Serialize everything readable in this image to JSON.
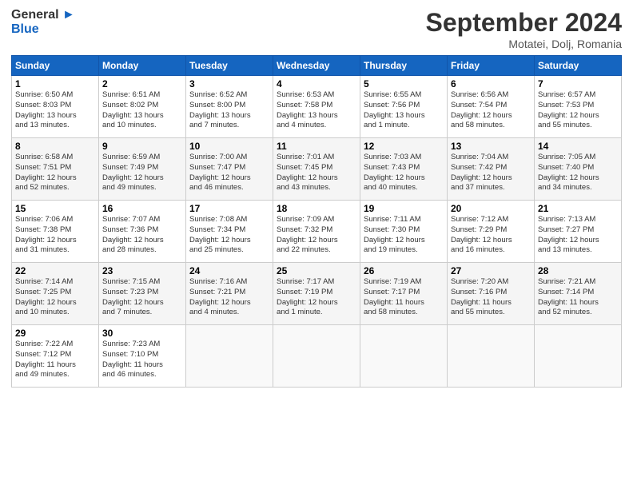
{
  "header": {
    "logo_line1": "General",
    "logo_line2": "Blue",
    "month": "September 2024",
    "location": "Motatei, Dolj, Romania"
  },
  "days_of_week": [
    "Sunday",
    "Monday",
    "Tuesday",
    "Wednesday",
    "Thursday",
    "Friday",
    "Saturday"
  ],
  "weeks": [
    [
      {
        "num": "1",
        "info": "Sunrise: 6:50 AM\nSunset: 8:03 PM\nDaylight: 13 hours\nand 13 minutes."
      },
      {
        "num": "2",
        "info": "Sunrise: 6:51 AM\nSunset: 8:02 PM\nDaylight: 13 hours\nand 10 minutes."
      },
      {
        "num": "3",
        "info": "Sunrise: 6:52 AM\nSunset: 8:00 PM\nDaylight: 13 hours\nand 7 minutes."
      },
      {
        "num": "4",
        "info": "Sunrise: 6:53 AM\nSunset: 7:58 PM\nDaylight: 13 hours\nand 4 minutes."
      },
      {
        "num": "5",
        "info": "Sunrise: 6:55 AM\nSunset: 7:56 PM\nDaylight: 13 hours\nand 1 minute."
      },
      {
        "num": "6",
        "info": "Sunrise: 6:56 AM\nSunset: 7:54 PM\nDaylight: 12 hours\nand 58 minutes."
      },
      {
        "num": "7",
        "info": "Sunrise: 6:57 AM\nSunset: 7:53 PM\nDaylight: 12 hours\nand 55 minutes."
      }
    ],
    [
      {
        "num": "8",
        "info": "Sunrise: 6:58 AM\nSunset: 7:51 PM\nDaylight: 12 hours\nand 52 minutes."
      },
      {
        "num": "9",
        "info": "Sunrise: 6:59 AM\nSunset: 7:49 PM\nDaylight: 12 hours\nand 49 minutes."
      },
      {
        "num": "10",
        "info": "Sunrise: 7:00 AM\nSunset: 7:47 PM\nDaylight: 12 hours\nand 46 minutes."
      },
      {
        "num": "11",
        "info": "Sunrise: 7:01 AM\nSunset: 7:45 PM\nDaylight: 12 hours\nand 43 minutes."
      },
      {
        "num": "12",
        "info": "Sunrise: 7:03 AM\nSunset: 7:43 PM\nDaylight: 12 hours\nand 40 minutes."
      },
      {
        "num": "13",
        "info": "Sunrise: 7:04 AM\nSunset: 7:42 PM\nDaylight: 12 hours\nand 37 minutes."
      },
      {
        "num": "14",
        "info": "Sunrise: 7:05 AM\nSunset: 7:40 PM\nDaylight: 12 hours\nand 34 minutes."
      }
    ],
    [
      {
        "num": "15",
        "info": "Sunrise: 7:06 AM\nSunset: 7:38 PM\nDaylight: 12 hours\nand 31 minutes."
      },
      {
        "num": "16",
        "info": "Sunrise: 7:07 AM\nSunset: 7:36 PM\nDaylight: 12 hours\nand 28 minutes."
      },
      {
        "num": "17",
        "info": "Sunrise: 7:08 AM\nSunset: 7:34 PM\nDaylight: 12 hours\nand 25 minutes."
      },
      {
        "num": "18",
        "info": "Sunrise: 7:09 AM\nSunset: 7:32 PM\nDaylight: 12 hours\nand 22 minutes."
      },
      {
        "num": "19",
        "info": "Sunrise: 7:11 AM\nSunset: 7:30 PM\nDaylight: 12 hours\nand 19 minutes."
      },
      {
        "num": "20",
        "info": "Sunrise: 7:12 AM\nSunset: 7:29 PM\nDaylight: 12 hours\nand 16 minutes."
      },
      {
        "num": "21",
        "info": "Sunrise: 7:13 AM\nSunset: 7:27 PM\nDaylight: 12 hours\nand 13 minutes."
      }
    ],
    [
      {
        "num": "22",
        "info": "Sunrise: 7:14 AM\nSunset: 7:25 PM\nDaylight: 12 hours\nand 10 minutes."
      },
      {
        "num": "23",
        "info": "Sunrise: 7:15 AM\nSunset: 7:23 PM\nDaylight: 12 hours\nand 7 minutes."
      },
      {
        "num": "24",
        "info": "Sunrise: 7:16 AM\nSunset: 7:21 PM\nDaylight: 12 hours\nand 4 minutes."
      },
      {
        "num": "25",
        "info": "Sunrise: 7:17 AM\nSunset: 7:19 PM\nDaylight: 12 hours\nand 1 minute."
      },
      {
        "num": "26",
        "info": "Sunrise: 7:19 AM\nSunset: 7:17 PM\nDaylight: 11 hours\nand 58 minutes."
      },
      {
        "num": "27",
        "info": "Sunrise: 7:20 AM\nSunset: 7:16 PM\nDaylight: 11 hours\nand 55 minutes."
      },
      {
        "num": "28",
        "info": "Sunrise: 7:21 AM\nSunset: 7:14 PM\nDaylight: 11 hours\nand 52 minutes."
      }
    ],
    [
      {
        "num": "29",
        "info": "Sunrise: 7:22 AM\nSunset: 7:12 PM\nDaylight: 11 hours\nand 49 minutes."
      },
      {
        "num": "30",
        "info": "Sunrise: 7:23 AM\nSunset: 7:10 PM\nDaylight: 11 hours\nand 46 minutes."
      },
      {
        "num": "",
        "info": ""
      },
      {
        "num": "",
        "info": ""
      },
      {
        "num": "",
        "info": ""
      },
      {
        "num": "",
        "info": ""
      },
      {
        "num": "",
        "info": ""
      }
    ]
  ]
}
